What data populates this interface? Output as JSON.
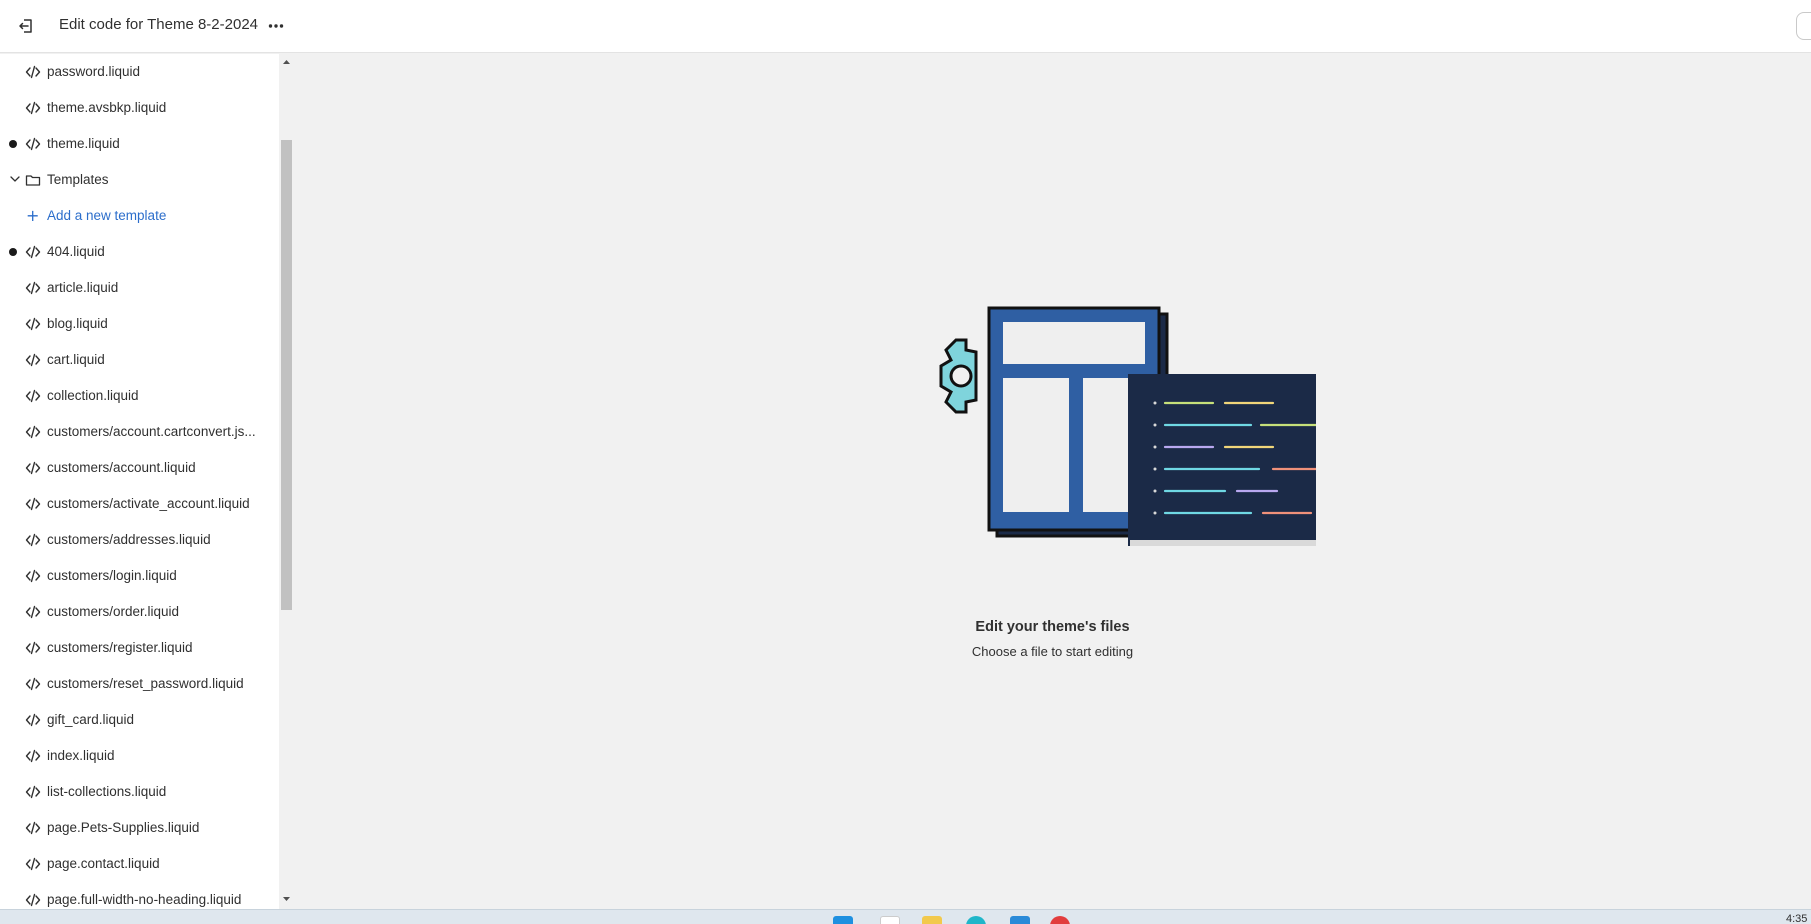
{
  "topbar": {
    "title": "Edit code for Theme 8-2-2024",
    "exit_icon": "exit-icon",
    "more_icon": "more-horizontal-icon"
  },
  "sidebar": {
    "items": [
      {
        "type": "file",
        "label": "password.liquid",
        "modified": false
      },
      {
        "type": "file",
        "label": "theme.avsbkp.liquid",
        "modified": false
      },
      {
        "type": "file",
        "label": "theme.liquid",
        "modified": true
      },
      {
        "type": "folder",
        "label": "Templates",
        "expanded": true
      },
      {
        "type": "add",
        "label": "Add a new template"
      },
      {
        "type": "file",
        "label": "404.liquid",
        "modified": true
      },
      {
        "type": "file",
        "label": "article.liquid",
        "modified": false
      },
      {
        "type": "file",
        "label": "blog.liquid",
        "modified": false
      },
      {
        "type": "file",
        "label": "cart.liquid",
        "modified": false
      },
      {
        "type": "file",
        "label": "collection.liquid",
        "modified": false
      },
      {
        "type": "file",
        "label": "customers/account.cartconvert.js...",
        "modified": false
      },
      {
        "type": "file",
        "label": "customers/account.liquid",
        "modified": false
      },
      {
        "type": "file",
        "label": "customers/activate_account.liquid",
        "modified": false
      },
      {
        "type": "file",
        "label": "customers/addresses.liquid",
        "modified": false
      },
      {
        "type": "file",
        "label": "customers/login.liquid",
        "modified": false
      },
      {
        "type": "file",
        "label": "customers/order.liquid",
        "modified": false
      },
      {
        "type": "file",
        "label": "customers/register.liquid",
        "modified": false
      },
      {
        "type": "file",
        "label": "customers/reset_password.liquid",
        "modified": false
      },
      {
        "type": "file",
        "label": "gift_card.liquid",
        "modified": false
      },
      {
        "type": "file",
        "label": "index.liquid",
        "modified": false
      },
      {
        "type": "file",
        "label": "list-collections.liquid",
        "modified": false
      },
      {
        "type": "file",
        "label": "page.Pets-Supplies.liquid",
        "modified": false
      },
      {
        "type": "file",
        "label": "page.contact.liquid",
        "modified": false
      },
      {
        "type": "file",
        "label": "page.full-width-no-heading.liquid",
        "modified": false
      }
    ]
  },
  "main": {
    "empty_title": "Edit your theme's files",
    "empty_subtitle": "Choose a file to start editing"
  },
  "colors": {
    "accent_link": "#2c6ecb",
    "illustration_blue": "#2f5fa3",
    "illustration_navy": "#1b2a47",
    "illustration_gear": "#7fd4dc"
  },
  "taskbar": {
    "time": "4:35"
  }
}
